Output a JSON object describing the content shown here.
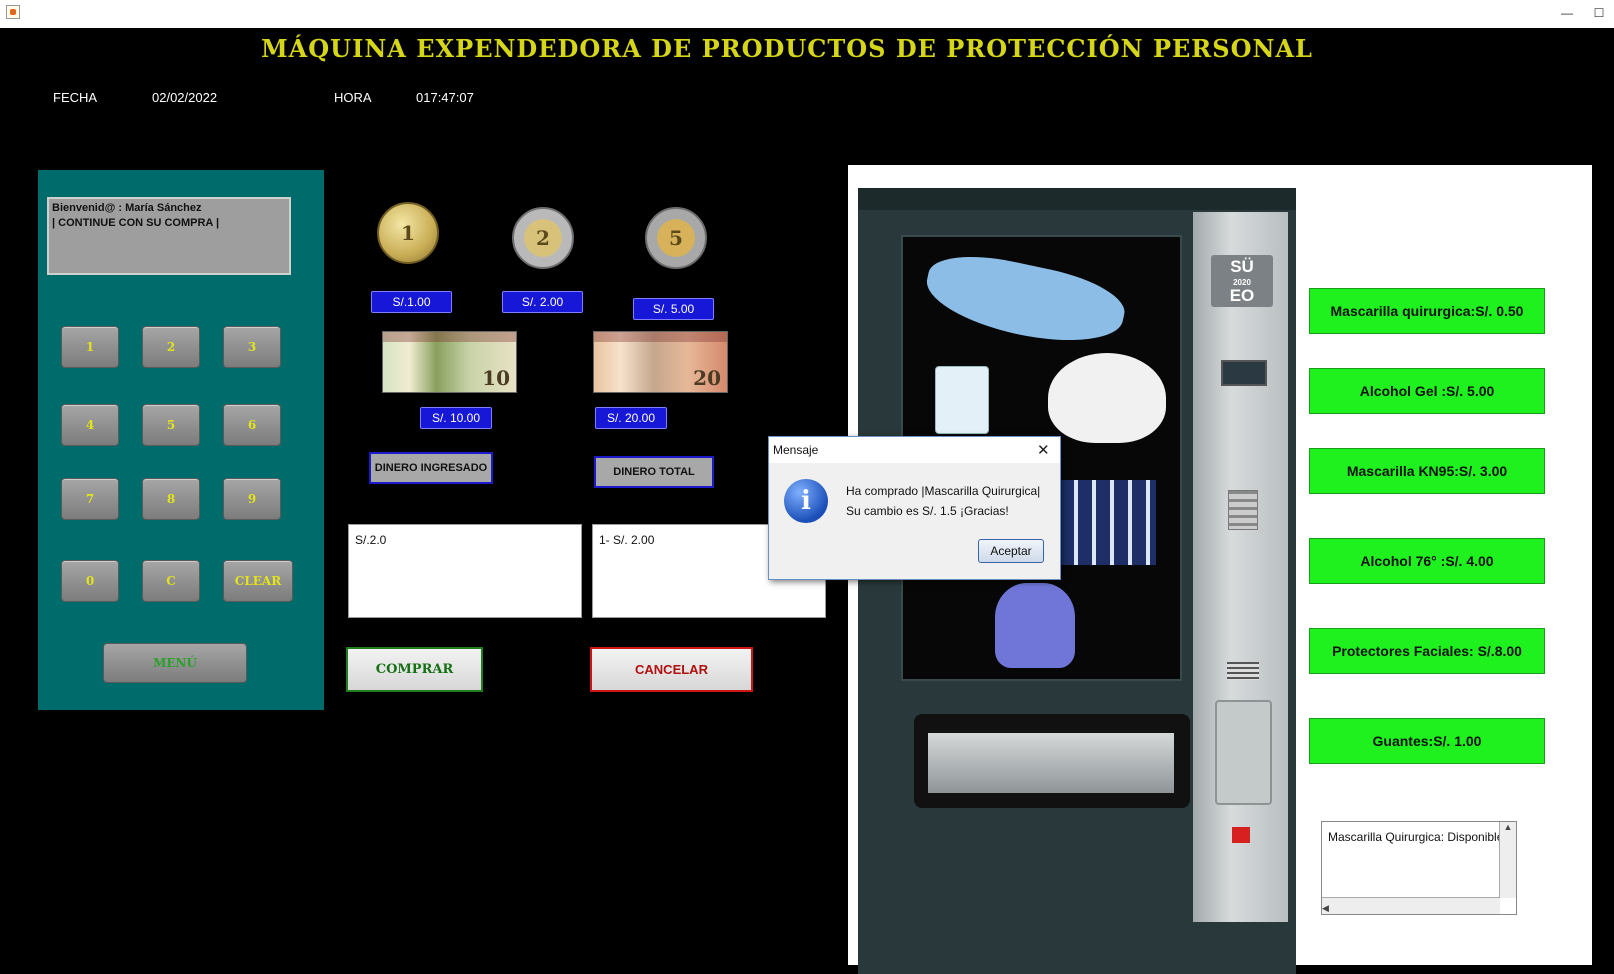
{
  "window": {
    "minimize": "—",
    "maximize": "☐"
  },
  "header": {
    "title": "MÁQUINA EXPENDEDORA DE PRODUCTOS DE PROTECCIÓN PERSONAL",
    "fecha_label": "FECHA",
    "fecha_value": "02/02/2022",
    "hora_label": "HORA",
    "hora_value": "017:47:07"
  },
  "display": {
    "line1": "Bienvenid@ : María Sánchez",
    "line2": "| CONTINUE CON  SU COMPRA |"
  },
  "keypad": {
    "keys": [
      "1",
      "2",
      "3",
      "4",
      "5",
      "6",
      "7",
      "8",
      "9",
      "0",
      "C",
      "CLEAR"
    ],
    "menu": "MENÚ"
  },
  "coins": {
    "c1": "1",
    "c2": "2",
    "c5": "5"
  },
  "bills": {
    "b10": "10",
    "b20": "20"
  },
  "money_buttons": {
    "s1": "S/.1.00",
    "s2": "S/. 2.00",
    "s5": "S/. 5.00",
    "s10": "S/. 10.00",
    "s20": "S/. 20.00"
  },
  "labels": {
    "ingresado": "DINERO INGRESADO",
    "total": "DINERO TOTAL"
  },
  "fields": {
    "ingresado_value": "S/.2.0",
    "total_value": "1- S/. 2.00"
  },
  "actions": {
    "comprar": "COMPRAR",
    "cancelar": "CANCELAR"
  },
  "machine": {
    "logo_top": "SÜ",
    "logo_year": "2020",
    "logo_bottom": "EO"
  },
  "products": [
    {
      "label": "Mascarilla quirurgica:S/. 0.50"
    },
    {
      "label": "Alcohol Gel :S/. 5.00"
    },
    {
      "label": "Mascarilla KN95:S/. 3.00"
    },
    {
      "label": "Alcohol 76° :S/. 4.00"
    },
    {
      "label": "Protectores Faciales: S/.8.00"
    },
    {
      "label": "Guantes:S/. 1.00"
    }
  ],
  "stock": {
    "text": "Mascarilla Quirurgica: Disponible"
  },
  "dialog": {
    "title": "Mensaje",
    "line1": "Ha comprado |Mascarilla Quirurgica|",
    "line2": "Su cambio es S/. 1.5 ¡Gracias!",
    "ok": "Aceptar",
    "icon": "i"
  },
  "colors": {
    "title": "#d6d618",
    "panel": "#006b6b",
    "product_button": "#1ff11f",
    "money_button": "#1717d8"
  }
}
